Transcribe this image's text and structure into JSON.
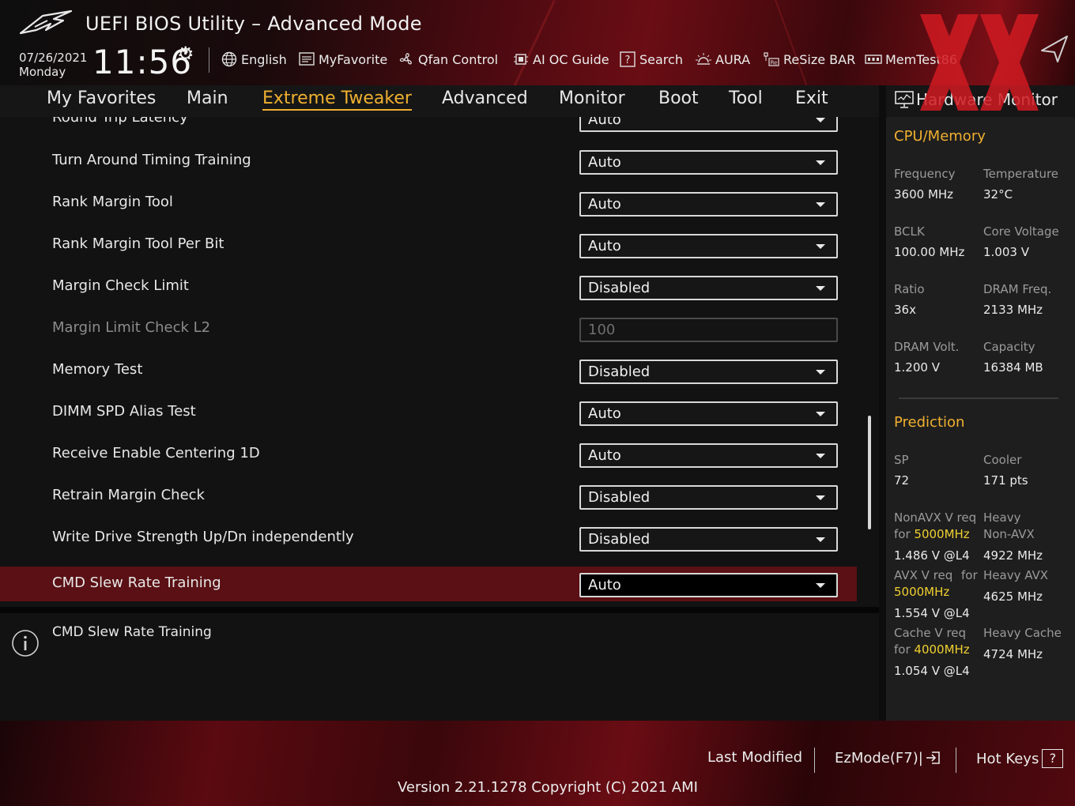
{
  "header": {
    "title": "UEFI BIOS Utility – Advanced Mode",
    "date": "07/26/2021",
    "weekday": "Monday",
    "time": "11:56",
    "tools": [
      {
        "label": "English",
        "icon": "globe-icon"
      },
      {
        "label": "MyFavorite",
        "icon": "favorite-list-icon"
      },
      {
        "label": "Qfan Control",
        "icon": "fan-icon"
      },
      {
        "label": "AI OC Guide",
        "icon": "chip-icon"
      },
      {
        "label": "Search",
        "icon": "help-search-icon"
      },
      {
        "label": "AURA",
        "icon": "aura-light-icon"
      },
      {
        "label": "ReSize BAR",
        "icon": "resize-bar-icon"
      },
      {
        "label": "MemTest86",
        "icon": "memory-icon"
      }
    ]
  },
  "menu": {
    "items": [
      "My Favorites",
      "Main",
      "Extreme Tweaker",
      "Advanced",
      "Monitor",
      "Boot",
      "Tool",
      "Exit"
    ],
    "active": "Extreme Tweaker"
  },
  "settings": {
    "partial_row": {
      "label": "Round Trip Latency",
      "value": "Auto"
    },
    "rows": [
      {
        "label": "Turn Around Timing Training",
        "value": "Auto"
      },
      {
        "label": "Rank Margin Tool",
        "value": "Auto"
      },
      {
        "label": "Rank Margin Tool Per Bit",
        "value": "Auto"
      },
      {
        "label": "Margin Check Limit",
        "value": "Disabled"
      },
      {
        "label": "Margin Limit Check L2",
        "value": "100"
      },
      {
        "label": "Memory Test",
        "value": "Disabled"
      },
      {
        "label": "DIMM SPD Alias Test",
        "value": "Auto"
      },
      {
        "label": "Receive Enable Centering 1D",
        "value": "Auto"
      },
      {
        "label": "Retrain Margin Check",
        "value": "Disabled"
      },
      {
        "label": "Write Drive Strength Up/Dn independently",
        "value": "Disabled"
      },
      {
        "label": "CMD Slew Rate Training",
        "value": "Auto"
      }
    ]
  },
  "help": {
    "text": "CMD Slew Rate Training"
  },
  "hw_monitor": {
    "title": "Hardware Monitor",
    "cpu_memory": {
      "heading": "CPU/Memory",
      "frequency_label": "Frequency",
      "frequency": "3600 MHz",
      "temperature_label": "Temperature",
      "temperature": "32°C",
      "bclk_label": "BCLK",
      "bclk": "100.00 MHz",
      "core_voltage_label": "Core Voltage",
      "core_voltage": "1.003 V",
      "ratio_label": "Ratio",
      "ratio": "36x",
      "dram_freq_label": "DRAM Freq.",
      "dram_freq": "2133 MHz",
      "dram_volt_label": "DRAM Volt.",
      "dram_volt": "1.200 V",
      "capacity_label": "Capacity",
      "capacity": "16384 MB"
    },
    "prediction": {
      "heading": "Prediction",
      "sp_label": "SP",
      "sp": "72",
      "cooler_label": "Cooler",
      "cooler": "171 pts",
      "nonavx_label": "NonAVX V req",
      "for_word": "for",
      "nonavx_freq": "5000MHz",
      "nonavx_v": "1.486 V @L4",
      "heavy_label": "Heavy",
      "non_avx_label": "Non-AVX",
      "heavy_nonavx": "4922 MHz",
      "avx_label": "AVX V req",
      "avx_for": "for",
      "avx_freq": "5000MHz",
      "avx_v": "1.554 V @L4",
      "heavy_avx_label": "Heavy AVX",
      "heavy_avx": "4625 MHz",
      "cache_label": "Cache V req",
      "cache_freq": "4000MHz",
      "cache_v": "1.054 V @L4",
      "heavy_cache_label": "Heavy Cache",
      "heavy_cache": "4724 MHz"
    }
  },
  "footer": {
    "last_modified": "Last Modified",
    "ezmode": "EzMode(F7)|",
    "hotkeys": "Hot Keys",
    "hotkeys_key": "?",
    "version": "Version 2.21.1278 Copyright (C) 2021 AMI"
  },
  "colors": {
    "accent": "#f0b030",
    "selected_row": "#5a1014",
    "highlight_value": "#f0d030"
  }
}
